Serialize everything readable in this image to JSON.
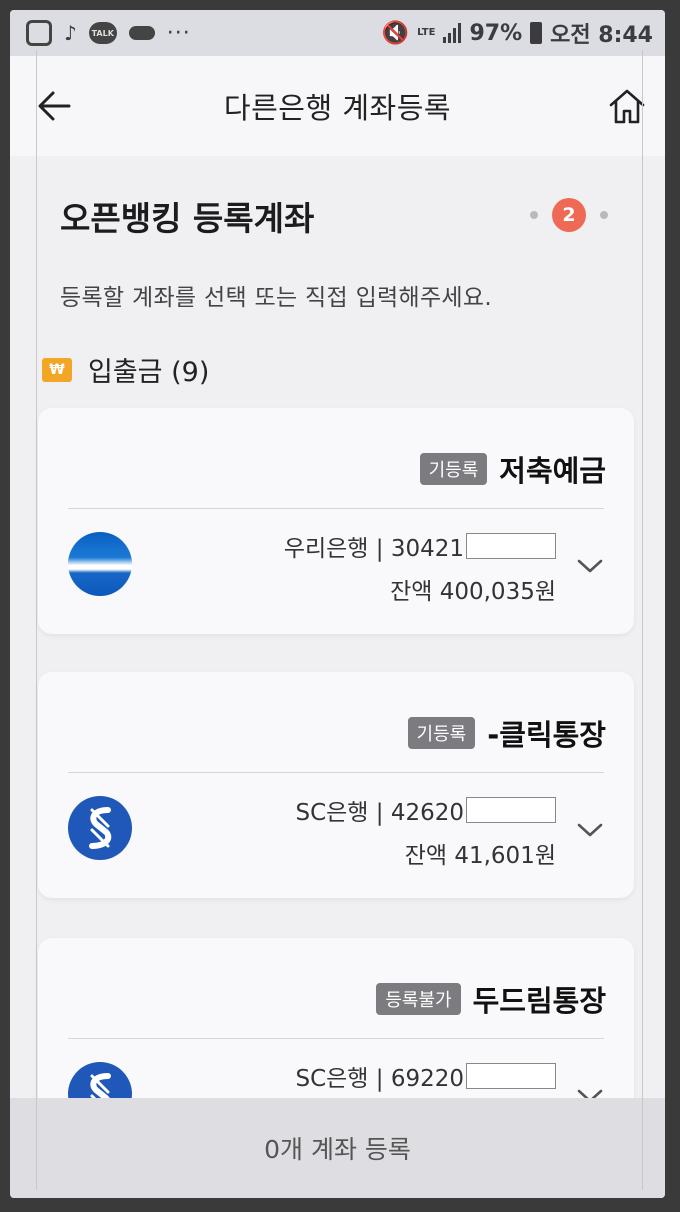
{
  "status_bar": {
    "talk_label": "TALK",
    "dots": "···",
    "lte": "LTE",
    "battery": "97%",
    "time": "오전 8:44"
  },
  "header": {
    "title": "다른은행 계좌등록"
  },
  "section": {
    "title": "오픈뱅킹 등록계좌",
    "current_step": "2",
    "instruction": "등록할 계좌를 선택 또는 직접 입력해주세요."
  },
  "category": {
    "icon_label": "₩",
    "label": "입출금 (9)"
  },
  "accounts": [
    {
      "badge": "기등록",
      "name": "저축예금",
      "bank": "우리은행",
      "account_prefix": "우리은행 | 30421",
      "balance": "잔액 400,035원",
      "logo_icon": "woori-bank-logo"
    },
    {
      "badge": "기등록",
      "name": "-클릭통장",
      "bank": "SC은행",
      "account_prefix": "SC은행 | 42620",
      "balance": "잔액 41,601원",
      "logo_icon": "sc-bank-logo"
    },
    {
      "badge": "등록불가",
      "name": "두드림통장",
      "bank": "SC은행",
      "account_prefix": "SC은행 | 69220",
      "balance": "",
      "logo_icon": "sc-bank-logo"
    }
  ],
  "bottom": {
    "register_label": "0개 계좌 등록"
  },
  "colors": {
    "step_accent": "#ef6a55",
    "won_icon": "#f2a625",
    "badge_bg": "#7b7b80"
  }
}
